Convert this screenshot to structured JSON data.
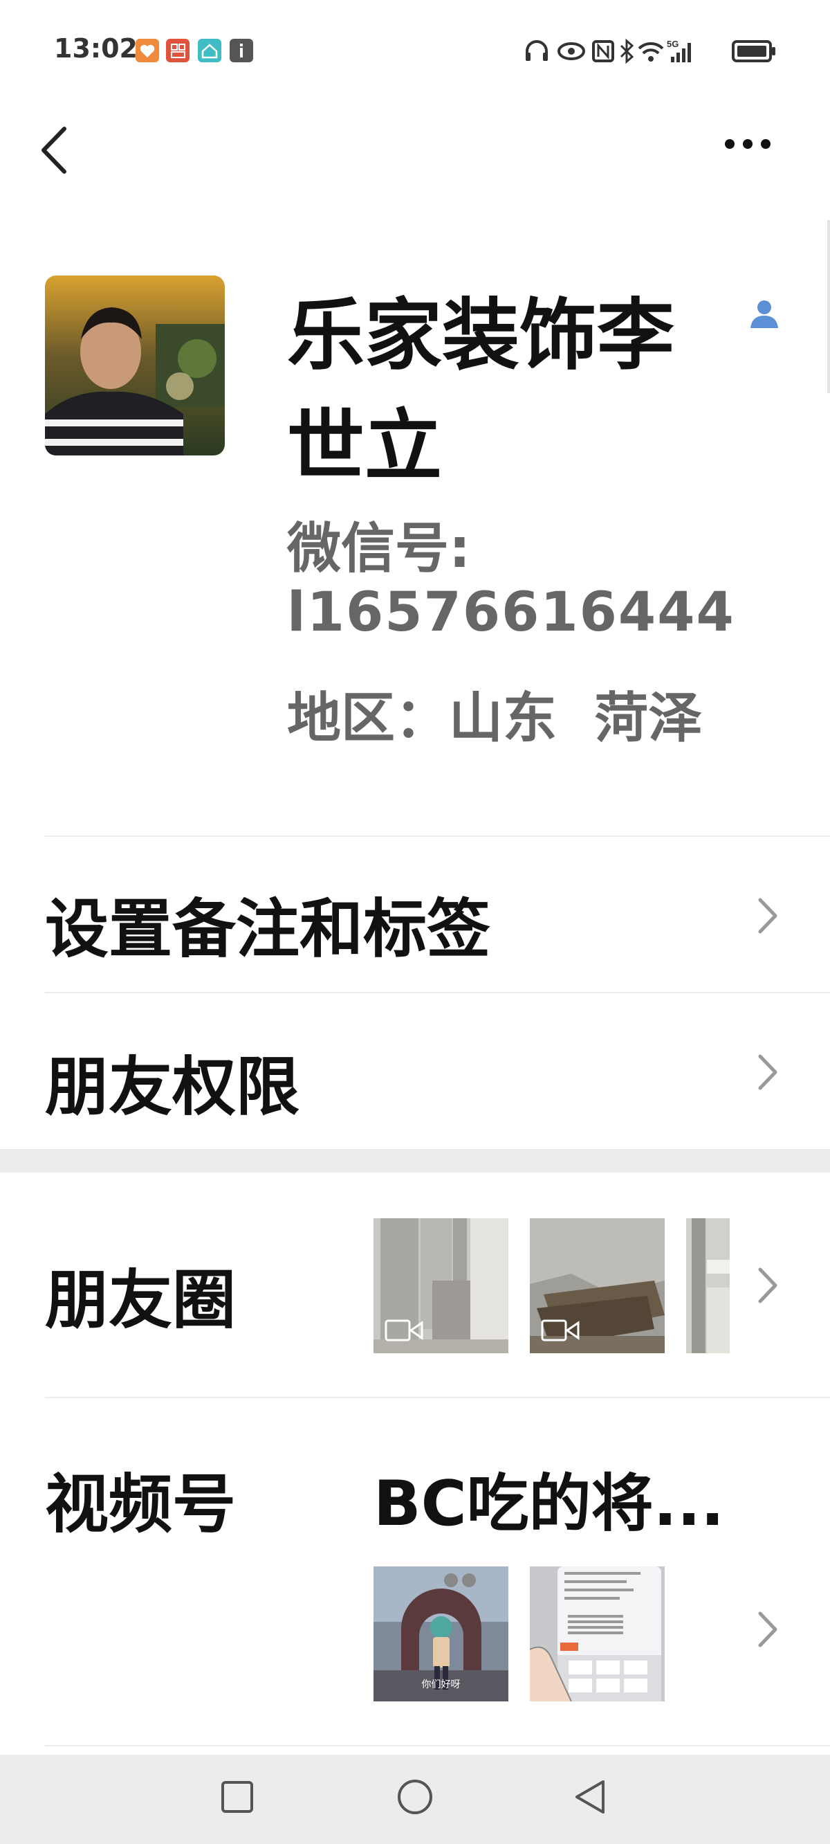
{
  "status_bar": {
    "time": "13:02",
    "app_icons": [
      "heart-app-icon",
      "grid-app-icon",
      "home-app-icon",
      "info-app-icon"
    ],
    "right_icons": [
      "headphones-icon",
      "eye-icon",
      "nfc-icon",
      "bluetooth-icon",
      "wifi-icon",
      "signal-5g-icon",
      "battery-icon"
    ],
    "network": "5G"
  },
  "header": {
    "back_icon": "chevron-left-icon",
    "more_icon": "more-dots-icon"
  },
  "profile": {
    "name": "乐家装饰李世立",
    "wechat_id_label": "微信号:",
    "wechat_id": "l16576616444",
    "region": "地区：山东  菏泽"
  },
  "rows": {
    "remark_tags": "设置备注和标签",
    "friend_permissions": "朋友权限",
    "moments": "朋友圈",
    "channels": "视频号",
    "channels_title": "BC吃的将..."
  },
  "channel_thumb_caption": "你们好呀",
  "colors": {
    "accent_blue": "#5b8fd6",
    "gray_text": "#666666",
    "divider": "#ececec"
  }
}
